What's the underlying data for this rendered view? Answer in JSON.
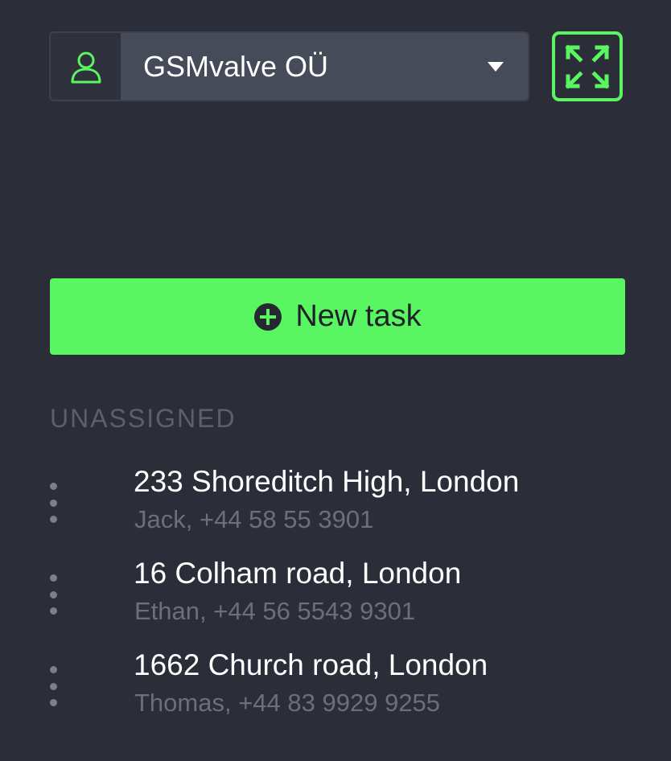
{
  "organization": {
    "name": "GSMvalve OÜ"
  },
  "actions": {
    "new_task_label": "New task"
  },
  "section": {
    "label": "UNASSIGNED"
  },
  "tasks": [
    {
      "address": "233 Shoreditch High, London",
      "contact": "Jack, +44 58 55 3901"
    },
    {
      "address": "16 Colham road, London",
      "contact": "Ethan, +44 56 5543 9301"
    },
    {
      "address": "1662 Church road, London",
      "contact": "Thomas, +44 83 9929 9255"
    }
  ],
  "icons": {
    "org_avatar": "user-icon",
    "dropdown": "caret-down-icon",
    "expand": "expand-icon",
    "new_task": "plus-circle-icon",
    "drag": "drag-handle-icon"
  },
  "colors": {
    "background": "#2b2e38",
    "accent": "#5af661",
    "select_bg": "#464b59",
    "muted_text": "#6a6f7a"
  }
}
